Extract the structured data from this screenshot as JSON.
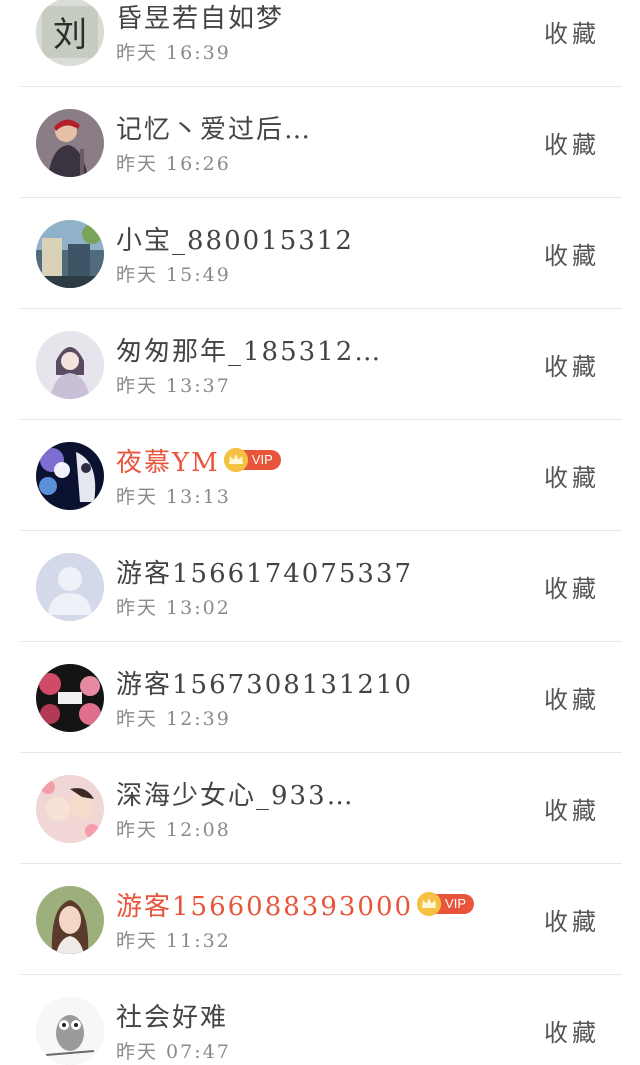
{
  "rows": [
    {
      "name": "昏昱若自如梦",
      "time": "昨天 16:39",
      "action": "收藏",
      "vip": false,
      "avatar": "avatar-liu-calligraphy",
      "avatar_text": "刘"
    },
    {
      "name": "记忆丶爱过后…",
      "time": "昨天 16:26",
      "action": "收藏",
      "vip": false,
      "avatar": "avatar-person-photo"
    },
    {
      "name": "小宝_880015312",
      "time": "昨天 15:49",
      "action": "收藏",
      "vip": false,
      "avatar": "avatar-street-photo"
    },
    {
      "name": "匆匆那年_185312…",
      "time": "昨天 13:37",
      "action": "收藏",
      "vip": false,
      "avatar": "avatar-anime-girl"
    },
    {
      "name": "夜慕YM",
      "time": "昨天 13:13",
      "action": "收藏",
      "vip": true,
      "vip_label": "VIP",
      "avatar": "avatar-flowers-dark"
    },
    {
      "name": "游客1566174075337",
      "time": "昨天 13:02",
      "action": "收藏",
      "vip": false,
      "avatar": "avatar-default-silhouette"
    },
    {
      "name": "游客1567308131210",
      "time": "昨天 12:39",
      "action": "收藏",
      "vip": false,
      "avatar": "avatar-roses-dark"
    },
    {
      "name": "深海少女心_933…",
      "time": "昨天 12:08",
      "action": "收藏",
      "vip": false,
      "avatar": "avatar-pink-girls"
    },
    {
      "name": "游客1566088393000",
      "time": "昨天 11:32",
      "action": "收藏",
      "vip": true,
      "vip_label": "VIP",
      "avatar": "avatar-woman-photo"
    },
    {
      "name": "社会好难",
      "time": "昨天 07:47",
      "action": "收藏",
      "vip": false,
      "avatar": "avatar-owl"
    }
  ],
  "colors": {
    "name": "#444444",
    "vip_name": "#e8553b",
    "time": "#8a8a8a",
    "divider": "#e6e6e6",
    "crown": "#f5c142"
  }
}
